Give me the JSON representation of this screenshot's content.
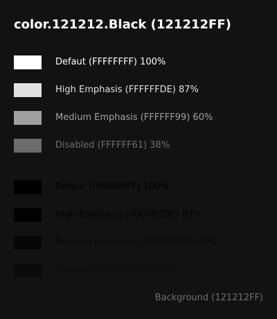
{
  "page": {
    "title": "color.121212.Black (121212FF)",
    "background": "#121212"
  },
  "white_group": [
    {
      "label": "Defaut (FFFFFFFF) 100%",
      "color": "rgba(255,255,255,1)"
    },
    {
      "label": "High Emphasis (FFFFFFDE) 87%",
      "color": "rgba(255,255,255,0.87)"
    },
    {
      "label": "Medium Emphasis (FFFFFF99) 60%",
      "color": "rgba(255,255,255,0.6)"
    },
    {
      "label": "Disabled (FFFFFF61) 38%",
      "color": "rgba(255,255,255,0.38)"
    }
  ],
  "black_group": [
    {
      "label": "Defaut (000000FF) 100%",
      "color": "rgba(0,0,0,1)"
    },
    {
      "label": "High Emphasis (000000DE) 87%",
      "color": "rgba(0,0,0,0.87)"
    },
    {
      "label": "Medium Emphasis (00000099) 60%",
      "color": "rgba(0,0,0,0.6)"
    },
    {
      "label": "Disabled (00000061) 38%",
      "color": "rgba(0,0,0,0.38)"
    }
  ],
  "footer": {
    "label": "Background (121212FF)",
    "color": "rgba(255,255,255,0.38)"
  }
}
